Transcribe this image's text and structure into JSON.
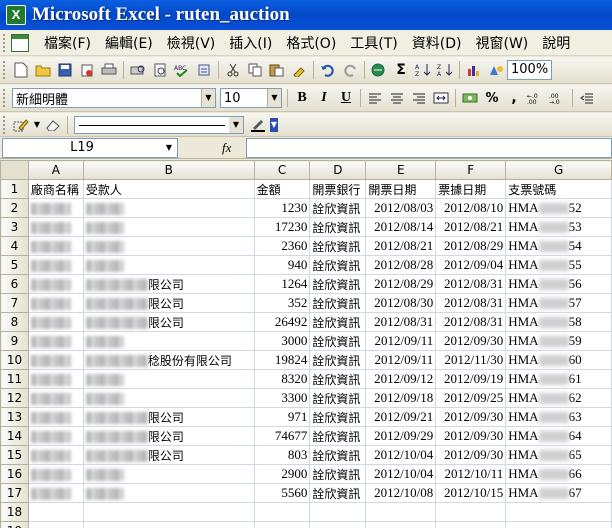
{
  "window": {
    "title": "Microsoft Excel - ruten_auction",
    "app_icon_letter": "X"
  },
  "menu": {
    "items": [
      "檔案(F)",
      "編輯(E)",
      "檢視(V)",
      "插入(I)",
      "格式(O)",
      "工具(T)",
      "資料(D)",
      "視窗(W)",
      "說明"
    ]
  },
  "toolbar": {
    "zoom": "100%",
    "font_name": "新細明體",
    "font_size": "10",
    "bold": "B",
    "italic": "I",
    "underline": "U",
    "percent": "%",
    "comma": ",",
    "sum": "Σ"
  },
  "formula_bar": {
    "name_box": "L19",
    "fx_label": "fx",
    "formula": ""
  },
  "sheet": {
    "columns": [
      "A",
      "B",
      "C",
      "D",
      "E",
      "F",
      "G"
    ],
    "header_row": [
      "廠商名稱",
      "受款人",
      "金額",
      "開票銀行",
      "開票日期",
      "票據日期",
      "支票號碼"
    ],
    "rows": [
      {
        "row": "2",
        "b_suffix": "",
        "amount": "1230",
        "bank": "詮欣資訊",
        "issue": "2012/08/03",
        "due": "2012/08/10",
        "chk_pre": "HMA",
        "chk_suf": "52"
      },
      {
        "row": "3",
        "b_suffix": "",
        "amount": "17230",
        "bank": "詮欣資訊",
        "issue": "2012/08/14",
        "due": "2012/08/21",
        "chk_pre": "HMA",
        "chk_suf": "53"
      },
      {
        "row": "4",
        "b_suffix": "",
        "amount": "2360",
        "bank": "詮欣資訊",
        "issue": "2012/08/21",
        "due": "2012/08/29",
        "chk_pre": "HMA",
        "chk_suf": "54"
      },
      {
        "row": "5",
        "b_suffix": "",
        "amount": "940",
        "bank": "詮欣資訊",
        "issue": "2012/08/28",
        "due": "2012/09/04",
        "chk_pre": "HMA",
        "chk_suf": "55"
      },
      {
        "row": "6",
        "b_suffix": "限公司",
        "amount": "1264",
        "bank": "詮欣資訊",
        "issue": "2012/08/29",
        "due": "2012/08/31",
        "chk_pre": "HMA",
        "chk_suf": "56"
      },
      {
        "row": "7",
        "b_suffix": "限公司",
        "amount": "352",
        "bank": "詮欣資訊",
        "issue": "2012/08/30",
        "due": "2012/08/31",
        "chk_pre": "HMA",
        "chk_suf": "57"
      },
      {
        "row": "8",
        "b_suffix": "限公司",
        "amount": "26492",
        "bank": "詮欣資訊",
        "issue": "2012/08/31",
        "due": "2012/08/31",
        "chk_pre": "HMA",
        "chk_suf": "58"
      },
      {
        "row": "9",
        "b_suffix": "",
        "amount": "3000",
        "bank": "詮欣資訊",
        "issue": "2012/09/11",
        "due": "2012/09/30",
        "chk_pre": "HMA",
        "chk_suf": "59"
      },
      {
        "row": "10",
        "b_suffix": "稔股份有限公司",
        "amount": "19824",
        "bank": "詮欣資訊",
        "issue": "2012/09/11",
        "due": "2012/11/30",
        "chk_pre": "HMA",
        "chk_suf": "60"
      },
      {
        "row": "11",
        "b_suffix": "",
        "amount": "8320",
        "bank": "詮欣資訊",
        "issue": "2012/09/12",
        "due": "2012/09/19",
        "chk_pre": "HMA",
        "chk_suf": "61"
      },
      {
        "row": "12",
        "b_suffix": "",
        "amount": "3300",
        "bank": "詮欣資訊",
        "issue": "2012/09/18",
        "due": "2012/09/25",
        "chk_pre": "HMA",
        "chk_suf": "62"
      },
      {
        "row": "13",
        "b_suffix": "限公司",
        "amount": "971",
        "bank": "詮欣資訊",
        "issue": "2012/09/21",
        "due": "2012/09/30",
        "chk_pre": "HMA",
        "chk_suf": "63"
      },
      {
        "row": "14",
        "b_suffix": "限公司",
        "amount": "74677",
        "bank": "詮欣資訊",
        "issue": "2012/09/29",
        "due": "2012/09/30",
        "chk_pre": "HMA",
        "chk_suf": "64"
      },
      {
        "row": "15",
        "b_suffix": "限公司",
        "amount": "803",
        "bank": "詮欣資訊",
        "issue": "2012/10/04",
        "due": "2012/09/30",
        "chk_pre": "HMA",
        "chk_suf": "65"
      },
      {
        "row": "16",
        "b_suffix": "",
        "amount": "2900",
        "bank": "詮欣資訊",
        "issue": "2012/10/04",
        "due": "2012/10/11",
        "chk_pre": "HMA",
        "chk_suf": "66"
      },
      {
        "row": "17",
        "b_suffix": "",
        "amount": "5560",
        "bank": "詮欣資訊",
        "issue": "2012/10/08",
        "due": "2012/10/15",
        "chk_pre": "HMA",
        "chk_suf": "67"
      }
    ],
    "empty_rows": [
      "18",
      "19"
    ],
    "first_row_label": "1"
  }
}
